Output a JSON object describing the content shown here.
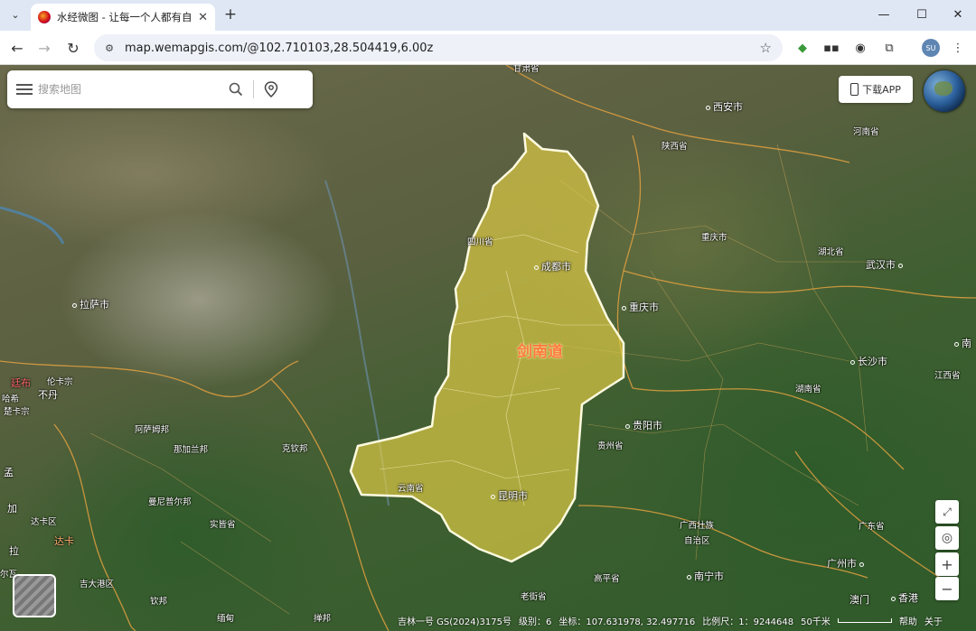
{
  "browser": {
    "tab_title": "水经微图 - 让每一个人都有自己",
    "url": "map.wemapgis.com/@102.710103,28.504419,6.00z"
  },
  "search": {
    "placeholder": "搜索地图"
  },
  "download_app": "下载APP",
  "region": {
    "name": "剑南道"
  },
  "labels": {
    "gansu": "甘肃省",
    "xian": "西安市",
    "shaanxi": "陕西省",
    "henan": "河南省",
    "sichuan": "四川省",
    "chengdu": "成都市",
    "chongqing_city": "重庆市",
    "chongqing_muni": "重庆市",
    "hubei": "湖北省",
    "wuhan": "武汉市",
    "lhasa": "拉萨市",
    "changsha": "长沙市",
    "hunan": "湖南省",
    "jiangxi": "江西省",
    "nan": "南",
    "guiyang": "贵阳市",
    "guizhou": "贵州省",
    "kunming": "昆明市",
    "yunnan": "云南省",
    "guangxi_1": "广西壮族",
    "guangxi_2": "自治区",
    "guangdong": "广东省",
    "guangzhou": "广州市",
    "nanning": "南宁市",
    "aomen": "澳门",
    "xianggang": "香港",
    "gaoping": "高平省",
    "laojie": "老街省",
    "tingbu": "廷布",
    "lunqian": "伦卡宗",
    "buding": "不丹",
    "zhakazong": "楚卡宗",
    "asam": "阿萨姆邦",
    "najia": "那加兰邦",
    "qinbang": "克钦邦",
    "manipur": "曼尼普尔邦",
    "shijie": "实皆省",
    "daka_qu": "达卡区",
    "daka": "达卡",
    "jida": "吉大港区",
    "qinbang2": "钦邦",
    "miandian": "缅甸",
    "panlong": "掸邦",
    "meng": "孟",
    "jia": "加",
    "la": "拉",
    "erwa": "尔瓦",
    "hashi": "哈希"
  },
  "status": {
    "source": "吉林一号 GS(2024)3175号",
    "level": "级别：6",
    "coord": "坐标：107.631978, 32.497716",
    "scale": "比例尺：1：9244648",
    "scale_bar": "50千米",
    "help": "帮助",
    "about": "关于"
  }
}
